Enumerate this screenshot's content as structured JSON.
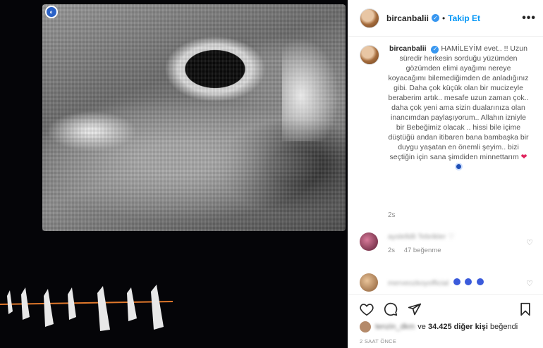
{
  "post": {
    "username": "bircanbalii",
    "follow_label": "Takip Et",
    "more_label": "•••"
  },
  "caption": {
    "username": "bircanbalii",
    "text": "HAMİLEYİM evet.. !! Uzun süredir herkesin sorduğu yüzümden gözümden elimi ayağımı nereye koyacağımı bilemediğimden de anladığınız gibi. Daha çok küçük olan bir mucizeyle beraberim artık.. mesafe uzun zaman çok.. daha çok yeni ama sizin dualarınıza olan inancımdan paylaşıyorum.. Allahın izniyle bir Bebeğimiz olacak .. hissi bile içime düştüğü andan itibaren bana bambaşka bir duygu yaşatan en önemli şeyim.. bizi seçtiğin için sana şimdiden minnettarım",
    "time": "2s"
  },
  "comments": [
    {
      "user": "ayslelldli",
      "text": "Tebrikler ♡",
      "time": "2s",
      "likes": "47 beğenme"
    },
    {
      "user": "merveozkoyofficial"
    }
  ],
  "likes": {
    "user": "tenzin_dkm",
    "and_label": "ve",
    "count": "34.425 diğer kişi",
    "suffix": "beğendi"
  },
  "date": "2 SAAT ÖNCE",
  "colors": {
    "accent": "#0095f6",
    "verified": "#3897f0",
    "heart": "#e0245e"
  },
  "icons": [
    "verified-badge-icon",
    "more-icon",
    "heart-icon",
    "comment-icon",
    "share-icon",
    "bookmark-icon"
  ]
}
